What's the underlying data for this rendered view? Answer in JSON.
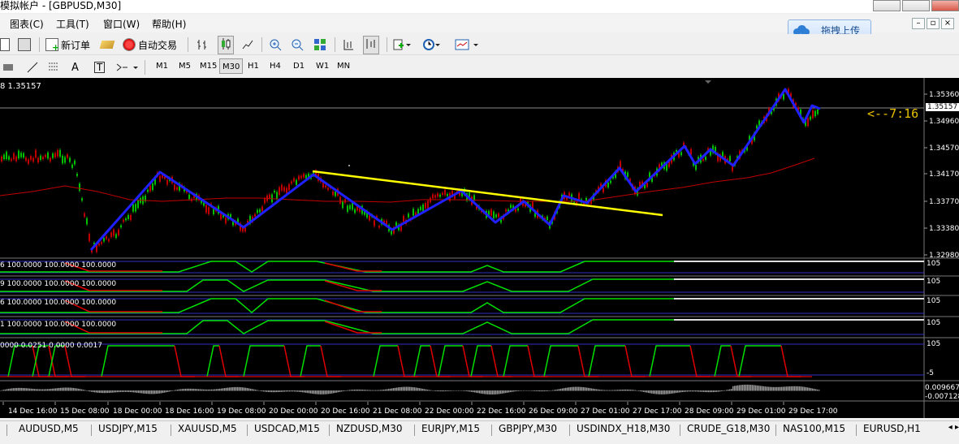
{
  "window": {
    "title": "模拟帐户 - [GBPUSD,M30]"
  },
  "menu": [
    "图表(C)",
    "工具(T)",
    "窗口(W)",
    "帮助(H)"
  ],
  "upload_button": {
    "label": "拖拽上传"
  },
  "toolbar": {
    "new_order": "新订单",
    "auto_trade": "自动交易",
    "timeframes": [
      "M1",
      "M5",
      "M15",
      "M30",
      "H1",
      "H4",
      "D1",
      "W1",
      "MN"
    ],
    "active_timeframe": "M30"
  },
  "chart": {
    "info_line": "8 1.35157",
    "countdown": "<--7:16",
    "price_label_current": "1.35157",
    "price_ticks": [
      "1.35360",
      "1.34960",
      "1.34570",
      "1.34170",
      "1.33770",
      "1.33380",
      "1.32980"
    ],
    "indicators": [
      {
        "label": "6 100.0000 100.0000 100.0000",
        "scale_top": "105"
      },
      {
        "label": "9 100.0000 100.0000 100.0000",
        "scale_top": "105"
      },
      {
        "label": "6 100.0000 100.0000 100.0000",
        "scale_top": "105"
      },
      {
        "label": "1 100.0000 100.0000 100.0000",
        "scale_top": "105"
      },
      {
        "label": "0000 0.0251 0.0000 0.0017",
        "scale_top": "105",
        "scale_bottom": "-5"
      }
    ],
    "histogram_scale": {
      "top": "0.009667",
      "bottom": "-0.007128"
    },
    "time_ticks": [
      "14 Dec 16:00",
      "15 Dec 08:00",
      "18 Dec 00:00",
      "18 Dec 16:00",
      "19 Dec 08:00",
      "20 Dec 00:00",
      "20 Dec 16:00",
      "21 Dec 08:00",
      "22 Dec 00:00",
      "22 Dec 16:00",
      "26 Dec 09:00",
      "27 Dec 01:00",
      "27 Dec 17:00",
      "28 Dec 09:00",
      "29 Dec 01:00",
      "29 Dec 17:00"
    ],
    "colors": {
      "zigzag": "#2020ff",
      "trendline": "#ffff00",
      "ma": "#c00000",
      "green": "#00e000",
      "red": "#e00000",
      "countdown": "#e8c000"
    }
  },
  "symbol_tabs": [
    "AUDUSD,M5",
    "USDJPY,M15",
    "XAUUSD,M5",
    "USDCAD,M15",
    "NZDUSD,M30",
    "EURJPY,M15",
    "GBPJPY,M30",
    "USDINDX_H18,M30",
    "CRUDE_G18,M30",
    "NAS100,M15",
    "EURUSD,H1"
  ]
}
